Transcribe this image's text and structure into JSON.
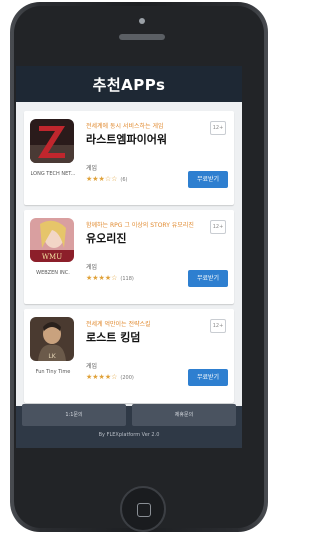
{
  "header": {
    "title": "추천APPs"
  },
  "apps": [
    {
      "subtitle": "전세계에 동시 서비스하는 게임",
      "title": "라스트엠파이어워",
      "developer": "LONG TECH NET...",
      "age": "12+",
      "category": "게임",
      "stars": "★★★☆☆",
      "rating_count": "(6)",
      "download_label": "무료받기",
      "icon_name": "last-empire-war-icon",
      "colors": {
        "bg": "#2a1b1b",
        "accent": "#c0262d"
      }
    },
    {
      "subtitle": "함께하는 RPG 그 이상의 STORY 유모리진",
      "title": "유오리진",
      "developer": "WEBZEN INC.",
      "age": "12+",
      "category": "게임",
      "stars": "★★★★☆",
      "rating_count": "(118)",
      "download_label": "무료받기",
      "icon_name": "mu-origin-icon",
      "colors": {
        "bg": "#d99fa0",
        "accent": "#8c1f2a"
      }
    },
    {
      "subtitle": "전세계 억만이는 전략스킬",
      "title": "로스트 킹덤",
      "developer": "Fun Tiny Time",
      "age": "12+",
      "category": "게임",
      "stars": "★★★★☆",
      "rating_count": "(200)",
      "download_label": "무료받기",
      "icon_name": "lost-kingdom-icon",
      "colors": {
        "bg": "#4a3a30",
        "accent": "#b07a4a"
      }
    }
  ],
  "footer": {
    "left_button": "1:1문의",
    "right_button": "제휴문의",
    "version": "By FLEXplatform Ver 2.0"
  },
  "colors": {
    "header_bg": "#1e2834",
    "download_button": "#2e7fd0",
    "subtitle": "#e0892e"
  }
}
